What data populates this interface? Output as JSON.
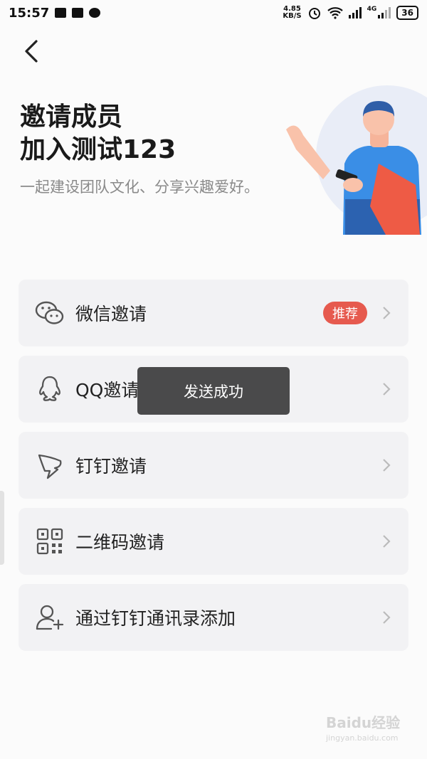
{
  "status_bar": {
    "time": "15:57",
    "speed_value": "4.85",
    "speed_unit": "KB/S",
    "network": "4G",
    "battery": "36"
  },
  "header": {
    "title_line1": "邀请成员",
    "title_line2": "加入测试123",
    "subtitle": "一起建设团队文化、分享兴趣爱好。"
  },
  "menu": {
    "items": [
      {
        "label": "微信邀请",
        "icon": "wechat-icon",
        "badge": "推荐"
      },
      {
        "label": "QQ邀请",
        "icon": "qq-icon"
      },
      {
        "label": "钉钉邀请",
        "icon": "dingtalk-icon"
      },
      {
        "label": "二维码邀请",
        "icon": "qrcode-icon"
      },
      {
        "label": "通过钉钉通讯录添加",
        "icon": "add-contact-icon"
      }
    ]
  },
  "toast": {
    "text": "发送成功"
  },
  "watermark": {
    "brand": "Baidu经验",
    "url": "jingyan.baidu.com"
  },
  "colors": {
    "badge": "#e65a4e",
    "card": "#f2f2f4",
    "toast": "#3c3c3c"
  }
}
